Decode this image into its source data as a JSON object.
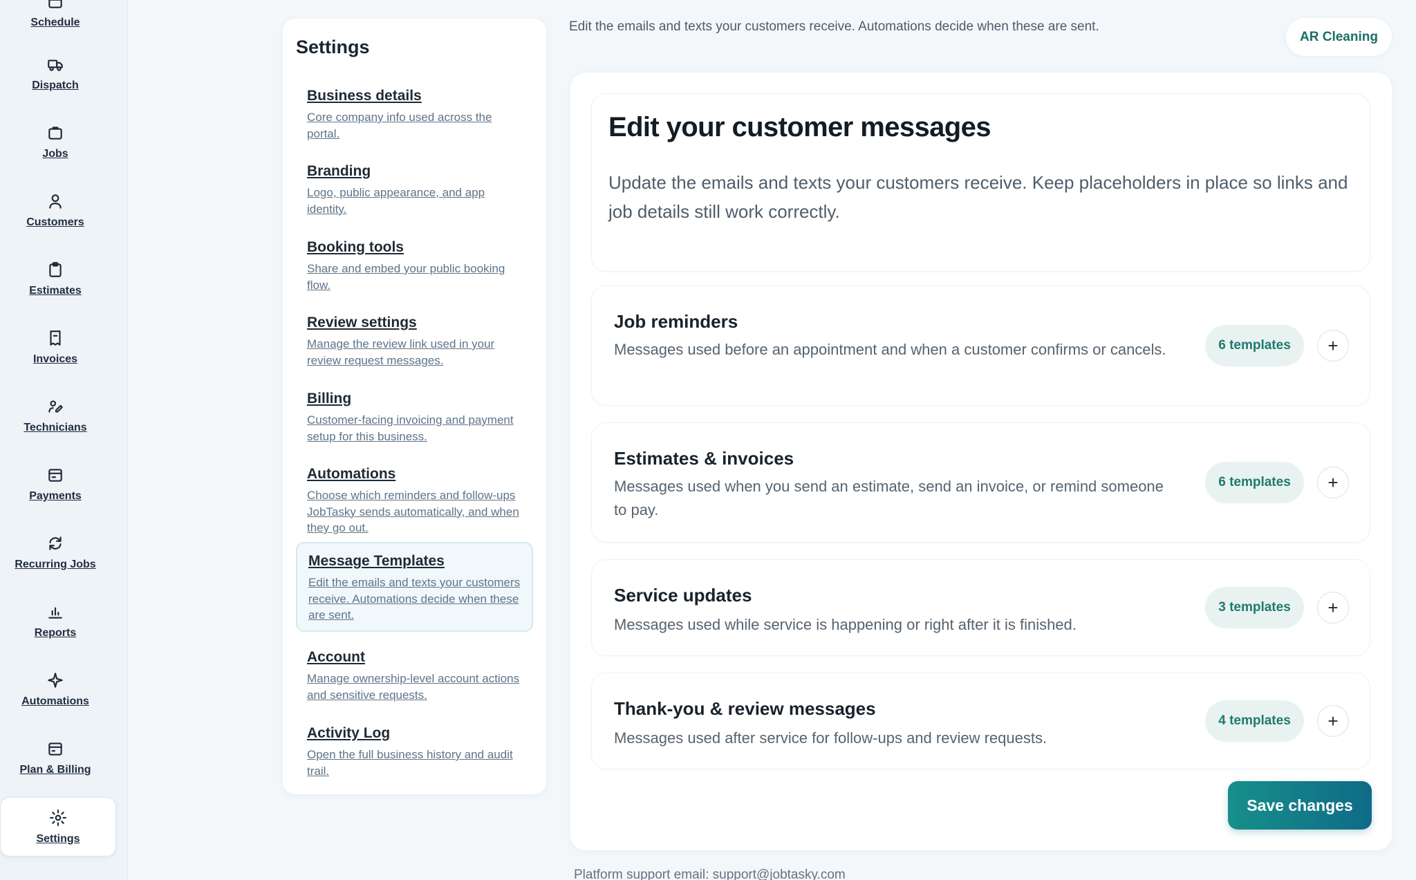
{
  "rail": {
    "items": [
      {
        "label": "Schedule",
        "icon": "calendar-icon"
      },
      {
        "label": "Dispatch",
        "icon": "truck-icon"
      },
      {
        "label": "Jobs",
        "icon": "briefcase-icon"
      },
      {
        "label": "Customers",
        "icon": "user-icon"
      },
      {
        "label": "Estimates",
        "icon": "clipboard-icon"
      },
      {
        "label": "Invoices",
        "icon": "receipt-icon"
      },
      {
        "label": "Technicians",
        "icon": "technician-icon"
      },
      {
        "label": "Payments",
        "icon": "wallet-icon"
      },
      {
        "label": "Recurring Jobs",
        "icon": "repeat-icon"
      },
      {
        "label": "Reports",
        "icon": "bar-chart-icon"
      },
      {
        "label": "Automations",
        "icon": "sparkle-icon"
      },
      {
        "label": "Plan & Billing",
        "icon": "credit-card-icon"
      },
      {
        "label": "Settings",
        "icon": "gear-icon",
        "active": true
      }
    ]
  },
  "settings_nav": {
    "title": "Settings",
    "items": [
      {
        "title": "Business details",
        "desc": "Core company info used across the portal."
      },
      {
        "title": "Branding",
        "desc": "Logo, public appearance, and app identity."
      },
      {
        "title": "Booking tools",
        "desc": "Share and embed your public booking flow."
      },
      {
        "title": "Review settings",
        "desc": "Manage the review link used in your review request messages."
      },
      {
        "title": "Billing",
        "desc": "Customer-facing invoicing and payment setup for this business."
      },
      {
        "title": "Automations",
        "desc": "Choose which reminders and follow-ups JobTasky sends automatically, and when they go out."
      },
      {
        "title": "Message Templates",
        "desc": "Edit the emails and texts your customers receive. Automations decide when these are sent.",
        "active": true
      },
      {
        "title": "Account",
        "desc": "Manage ownership-level account actions and sensitive requests."
      },
      {
        "title": "Activity Log",
        "desc": "Open the full business history and audit trail."
      }
    ]
  },
  "header": {
    "description": "Edit the emails and texts your customers receive. Automations decide when these are sent.",
    "business_name": "AR Cleaning"
  },
  "hero": {
    "title": "Edit your customer messages",
    "body": "Update the emails and texts your customers receive. Keep placeholders in place so links and job details still work correctly."
  },
  "groups": [
    {
      "title": "Job reminders",
      "desc": "Messages used before an appointment and when a customer confirms or cancels.",
      "count": "6 templates"
    },
    {
      "title": "Estimates & invoices",
      "desc": "Messages used when you send an estimate, send an invoice, or remind someone to pay.",
      "count": "6 templates"
    },
    {
      "title": "Service updates",
      "desc": "Messages used while service is happening or right after it is finished.",
      "count": "3 templates"
    },
    {
      "title": "Thank-you & review messages",
      "desc": "Messages used after service for follow-ups and review requests.",
      "count": "4 templates"
    }
  ],
  "add_label": "+",
  "save_label": "Save changes",
  "footer": {
    "support_email": "Platform support email: support@jobtasky.com"
  },
  "colors": {
    "accent": "#1a6f66",
    "button_gradient_start": "#178f8a",
    "button_gradient_end": "#0f6b88",
    "badge_bg": "#e8f3f1"
  }
}
